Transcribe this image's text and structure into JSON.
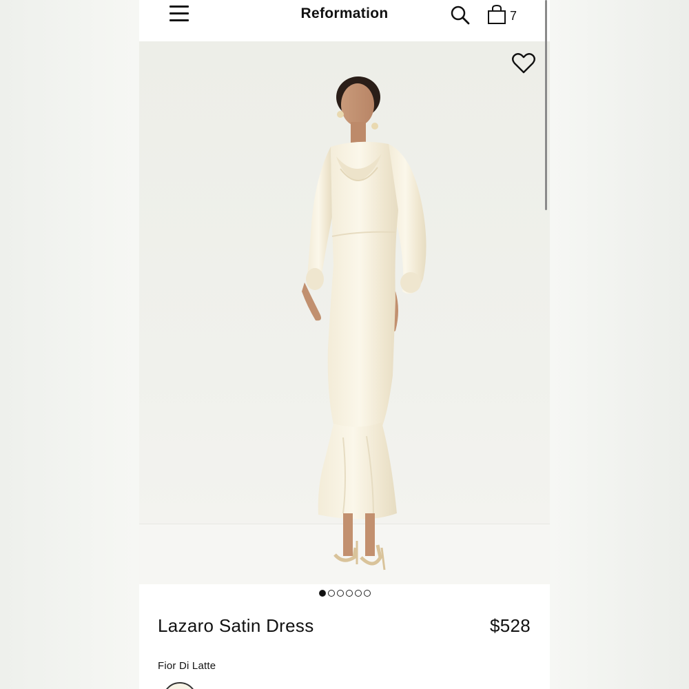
{
  "header": {
    "brand": "Reformation",
    "menu_icon": "hamburger-menu-icon",
    "search_icon": "search-icon",
    "bag_icon": "shopping-bag-icon",
    "bag_count": "7"
  },
  "gallery": {
    "favorite_icon": "heart-outline-icon",
    "image_alt": "Model wearing Lazaro Satin Dress",
    "total_images": 6,
    "active_index": 0
  },
  "product": {
    "name": "Lazaro Satin Dress",
    "price": "$528",
    "color_name": "Fior Di Latte",
    "swatch_color": "#f7f3e6"
  },
  "colors": {
    "background": "#f4f4f2",
    "hero_background": "#eeefea",
    "text": "#111111"
  }
}
